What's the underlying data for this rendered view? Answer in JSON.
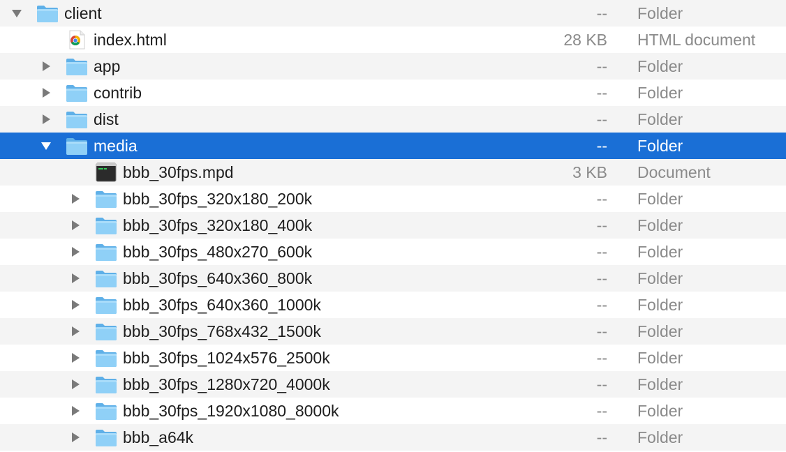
{
  "accent_color": "#1a6fd6",
  "rows": [
    {
      "name": "client",
      "size": "--",
      "kind": "Folder",
      "icon": "folder-icon",
      "disclosure": "expanded",
      "depth": 0
    },
    {
      "name": "index.html",
      "size": "28 KB",
      "kind": "HTML document",
      "icon": "chrome-html-icon",
      "disclosure": "none",
      "depth": 1
    },
    {
      "name": "app",
      "size": "--",
      "kind": "Folder",
      "icon": "folder-icon",
      "disclosure": "collapsed",
      "depth": 1
    },
    {
      "name": "contrib",
      "size": "--",
      "kind": "Folder",
      "icon": "folder-icon",
      "disclosure": "collapsed",
      "depth": 1
    },
    {
      "name": "dist",
      "size": "--",
      "kind": "Folder",
      "icon": "folder-icon",
      "disclosure": "collapsed",
      "depth": 1
    },
    {
      "name": "media",
      "size": "--",
      "kind": "Folder",
      "icon": "folder-icon",
      "disclosure": "expanded",
      "depth": 1,
      "selected": true
    },
    {
      "name": "bbb_30fps.mpd",
      "size": "3 KB",
      "kind": "Document",
      "icon": "terminal-document-icon",
      "disclosure": "none",
      "depth": 2
    },
    {
      "name": "bbb_30fps_320x180_200k",
      "size": "--",
      "kind": "Folder",
      "icon": "folder-icon",
      "disclosure": "collapsed",
      "depth": 2
    },
    {
      "name": "bbb_30fps_320x180_400k",
      "size": "--",
      "kind": "Folder",
      "icon": "folder-icon",
      "disclosure": "collapsed",
      "depth": 2
    },
    {
      "name": "bbb_30fps_480x270_600k",
      "size": "--",
      "kind": "Folder",
      "icon": "folder-icon",
      "disclosure": "collapsed",
      "depth": 2
    },
    {
      "name": "bbb_30fps_640x360_800k",
      "size": "--",
      "kind": "Folder",
      "icon": "folder-icon",
      "disclosure": "collapsed",
      "depth": 2
    },
    {
      "name": "bbb_30fps_640x360_1000k",
      "size": "--",
      "kind": "Folder",
      "icon": "folder-icon",
      "disclosure": "collapsed",
      "depth": 2
    },
    {
      "name": "bbb_30fps_768x432_1500k",
      "size": "--",
      "kind": "Folder",
      "icon": "folder-icon",
      "disclosure": "collapsed",
      "depth": 2
    },
    {
      "name": "bbb_30fps_1024x576_2500k",
      "size": "--",
      "kind": "Folder",
      "icon": "folder-icon",
      "disclosure": "collapsed",
      "depth": 2
    },
    {
      "name": "bbb_30fps_1280x720_4000k",
      "size": "--",
      "kind": "Folder",
      "icon": "folder-icon",
      "disclosure": "collapsed",
      "depth": 2
    },
    {
      "name": "bbb_30fps_1920x1080_8000k",
      "size": "--",
      "kind": "Folder",
      "icon": "folder-icon",
      "disclosure": "collapsed",
      "depth": 2
    },
    {
      "name": "bbb_a64k",
      "size": "--",
      "kind": "Folder",
      "icon": "folder-icon",
      "disclosure": "collapsed",
      "depth": 2
    }
  ]
}
